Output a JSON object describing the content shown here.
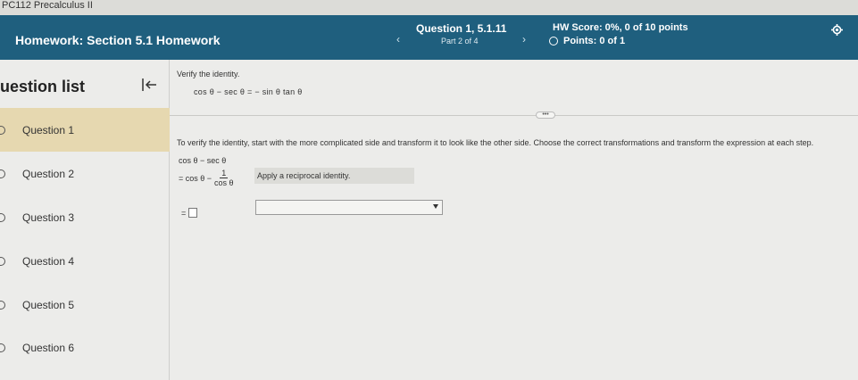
{
  "window": {
    "tab_title": "PC112 Precalculus II"
  },
  "header": {
    "homework_title": "Homework: Section 5.1 Homework",
    "prev_icon": "chevron-left-icon",
    "next_icon": "chevron-right-icon",
    "question_label": "Question 1, 5.1.11",
    "part_label": "Part 2 of 4",
    "hw_score": "HW Score: 0%, 0 of 10 points",
    "points": "Points: 0 of 1",
    "settings_icon": "gear-icon"
  },
  "sidebar": {
    "title": "uestion list",
    "collapse_icon": "collapse-left-icon",
    "items": [
      {
        "label": "Question 1",
        "active": true
      },
      {
        "label": "Question 2",
        "active": false
      },
      {
        "label": "Question 3",
        "active": false
      },
      {
        "label": "Question 4",
        "active": false
      },
      {
        "label": "Question 5",
        "active": false
      },
      {
        "label": "Question 6",
        "active": false
      }
    ]
  },
  "problem": {
    "prompt": "Verify the identity.",
    "identity": "cos θ − sec θ = − sin θ tan θ",
    "more_button": "•••",
    "instructions": "To verify the identity, start with the more complicated side and transform it to look like the other side. Choose the correct transformations and transform the expression at each step.",
    "step1": "cos θ − sec θ",
    "step2_prefix": "= cos θ −",
    "step2_num": "1",
    "step2_den": "cos θ",
    "step2_hint": "Apply a reciprocal identity.",
    "step3_prefix": "=",
    "step3_answer": "",
    "step3_reason": ""
  },
  "colors": {
    "header_bg": "#1f5f7e",
    "active_item_bg": "#e6d8b0"
  }
}
